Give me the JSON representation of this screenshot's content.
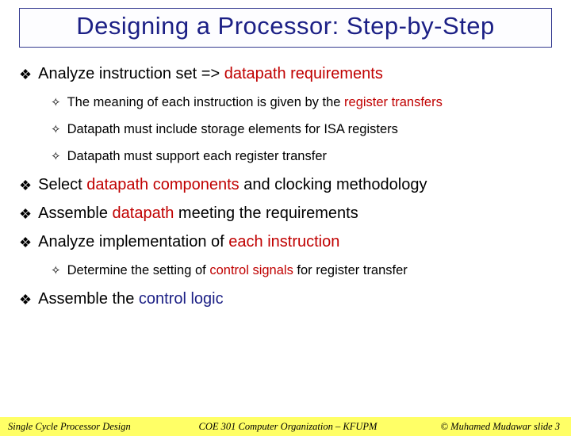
{
  "title": "Designing a Processor: Step-by-Step",
  "bullets": {
    "b1_pre": "Analyze instruction set => ",
    "b1_hl": "datapath requirements",
    "b1a_pre": "The meaning of each instruction is given by the ",
    "b1a_hl": "register transfers",
    "b1b": "Datapath must include storage elements for ISA registers",
    "b1c": "Datapath must support each register transfer",
    "b2_pre": "Select ",
    "b2_hl": "datapath components",
    "b2_post": " and clocking methodology",
    "b3_pre": "Assemble ",
    "b3_hl": "datapath",
    "b3_post": " meeting the requirements",
    "b4_pre": "Analyze implementation of ",
    "b4_hl": "each instruction",
    "b4a_pre": "Determine the setting of ",
    "b4a_hl": "control signals",
    "b4a_post": " for register transfer",
    "b5_pre": "Assemble the ",
    "b5_hl": "control logic"
  },
  "footer": {
    "left": "Single Cycle Processor Design",
    "center": "COE 301 Computer Organization – KFUPM",
    "right": "© Muhamed Mudawar  slide 3"
  }
}
